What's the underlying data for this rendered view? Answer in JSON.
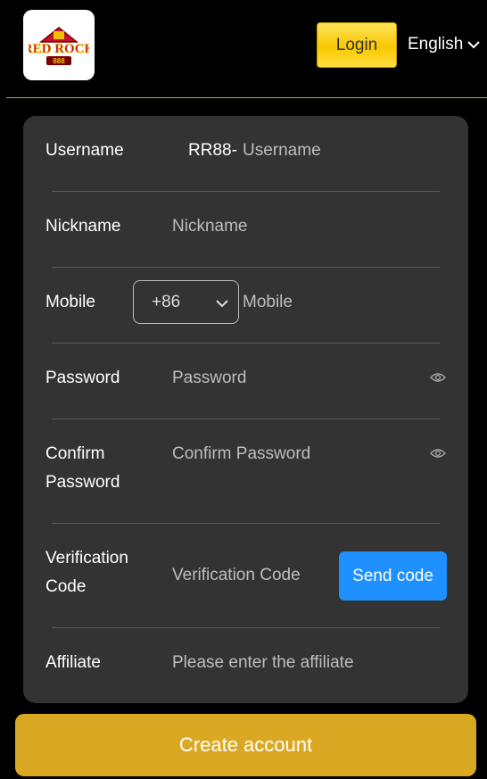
{
  "header": {
    "logo_text": "RED ROCK",
    "logo_subtext": "888",
    "login_label": "Login",
    "language_label": "English"
  },
  "form": {
    "username": {
      "label": "Username",
      "prefix": "RR88-",
      "placeholder": "Username"
    },
    "nickname": {
      "label": "Nickname",
      "placeholder": "Nickname"
    },
    "mobile": {
      "label": "Mobile",
      "country_code": "+86",
      "placeholder": "Mobile"
    },
    "password": {
      "label": "Password",
      "placeholder": "Password"
    },
    "confirm_password": {
      "label_line1": "Confirm",
      "label_line2": "Password",
      "placeholder": "Confirm Password"
    },
    "verification": {
      "label_line1": "Verification",
      "label_line2": "Code",
      "placeholder": "Verification Code",
      "send_label": "Send code"
    },
    "affiliate": {
      "label": "Affiliate",
      "placeholder": "Please enter the affiliate"
    }
  },
  "create_label": "Create account",
  "colors": {
    "accent": "#dba823",
    "login_button": "#f8c800",
    "send_button": "#1e90ff",
    "card": "#333333"
  }
}
